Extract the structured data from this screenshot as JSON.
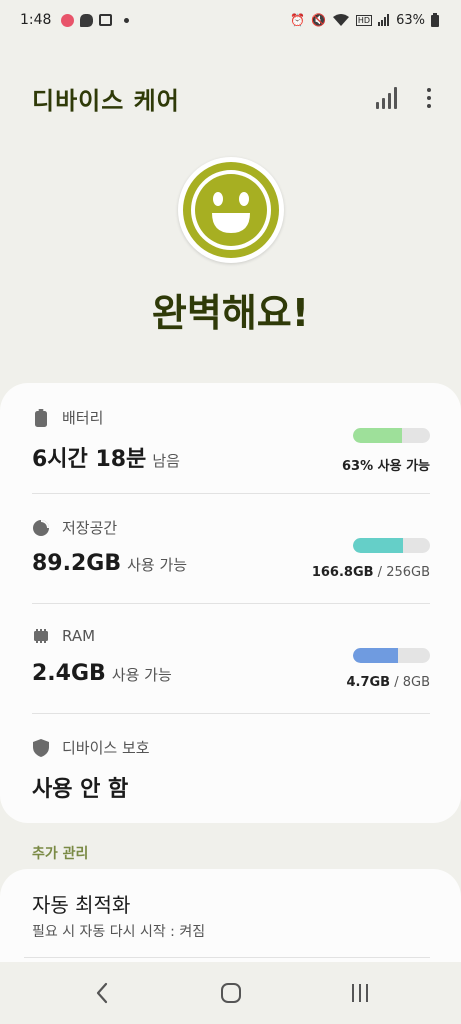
{
  "status_bar": {
    "time": "1:48",
    "battery_pct": "63%",
    "notification_icons": [
      "alert-icon",
      "kakaotalk-icon",
      "gallery-icon",
      "more-notifications-dot"
    ],
    "system_icons": [
      "alarm-icon",
      "mute-icon",
      "wifi-icon",
      "volte-icon",
      "cell-signal-icon",
      "battery-icon"
    ]
  },
  "appbar": {
    "title": "디바이스 케어"
  },
  "overall": {
    "status": "완벽해요!",
    "face_color": "#a7af22"
  },
  "items": {
    "battery": {
      "label": "배터리",
      "value": "6시간 18분",
      "value_suffix": "남음",
      "detail_strong": "63% 사용 가능",
      "detail_muted": "",
      "fill_fraction": 0.63,
      "color": "#9ee09a"
    },
    "storage": {
      "label": "저장공간",
      "value": "89.2GB",
      "value_suffix": "사용 가능",
      "detail_strong": "166.8GB",
      "detail_muted": " / 256GB",
      "fill_fraction": 0.65,
      "color": "#65cfc8"
    },
    "ram": {
      "label": "RAM",
      "value": "2.4GB",
      "value_suffix": "사용 가능",
      "detail_strong": "4.7GB",
      "detail_muted": " / 8GB",
      "fill_fraction": 0.59,
      "color": "#6f9be0"
    },
    "protection": {
      "label": "디바이스 보호",
      "value": "사용 안 함"
    }
  },
  "additional": {
    "section_label": "추가 관리",
    "auto_opt_title": "자동 최적화",
    "auto_opt_desc": "필요 시 자동 다시 시작 : 켜짐"
  },
  "navbar": {
    "buttons": [
      "back-icon",
      "home-icon",
      "recents-icon"
    ]
  }
}
